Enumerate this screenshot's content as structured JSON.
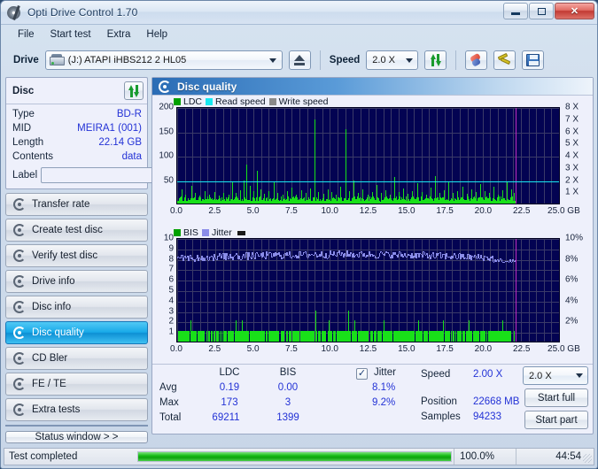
{
  "window": {
    "title": "Opti Drive Control 1.70",
    "icon": "disc-icon",
    "minimize_label": "–",
    "maximize_label": "□",
    "close_label": "✖"
  },
  "menu": {
    "items": [
      "File",
      "Start test",
      "Extra",
      "Help"
    ]
  },
  "toolbar": {
    "drive_label": "Drive",
    "drive_value": "(J:)  ATAPI iHBS212  2 HL05",
    "eject_label": "eject",
    "speed_label": "Speed",
    "speed_value": "2.0 X",
    "refresh_icon": "refresh-arrows-icon",
    "erase_icon": "erase-icon",
    "tools_icon": "tools-icon",
    "save_icon": "save-icon"
  },
  "disc_panel": {
    "title": "Disc",
    "refresh_icon": "refresh-arrows-icon",
    "rows": [
      {
        "key": "Type",
        "value": "BD-R"
      },
      {
        "key": "MID",
        "value": "MEIRA1 (001)"
      },
      {
        "key": "Length",
        "value": "22.14 GB"
      },
      {
        "key": "Contents",
        "value": "data"
      }
    ],
    "label_key": "Label",
    "label_value": "",
    "label_placeholder": "",
    "disc_icon": "cd-disc-icon"
  },
  "nav": {
    "items": [
      {
        "label": "Transfer rate",
        "active": false
      },
      {
        "label": "Create test disc",
        "active": false
      },
      {
        "label": "Verify test disc",
        "active": false
      },
      {
        "label": "Drive info",
        "active": false
      },
      {
        "label": "Disc info",
        "active": false
      },
      {
        "label": "Disc quality",
        "active": true
      },
      {
        "label": "CD Bler",
        "active": false
      },
      {
        "label": "FE / TE",
        "active": false
      },
      {
        "label": "Extra tests",
        "active": false
      }
    ],
    "status_window_label": "Status window > >"
  },
  "content": {
    "title": "Disc quality",
    "icon": "disc-quality-icon"
  },
  "chart_data": [
    {
      "type": "line",
      "name": "ldc-chart",
      "title": "",
      "xlabel": "GB",
      "ylabel": "",
      "xlim": [
        0.0,
        25.0
      ],
      "ylim": [
        0,
        200
      ],
      "y2lim": [
        0,
        8
      ],
      "y2label": "X",
      "grid": true,
      "legend_position": "top-left",
      "legend": [
        {
          "label": "LDC",
          "color": "#00a000"
        },
        {
          "label": "Read speed",
          "color": "#18e8f0"
        },
        {
          "label": "Write speed",
          "color": "#8a8a8a"
        }
      ],
      "xticks": [
        "0.0",
        "2.5",
        "5.0",
        "7.5",
        "10.0",
        "12.5",
        "15.0",
        "17.5",
        "20.0",
        "22.5",
        "25.0 GB"
      ],
      "xtick_values": [
        0,
        2.5,
        5,
        7.5,
        10,
        12.5,
        15,
        17.5,
        20,
        22.5,
        25
      ],
      "yticks": [
        "50",
        "100",
        "150",
        "200"
      ],
      "ytick_values": [
        50,
        100,
        150,
        200
      ],
      "y2ticks": [
        "1 X",
        "2 X",
        "3 X",
        "4 X",
        "5 X",
        "6 X",
        "7 X",
        "8 X"
      ],
      "y2tick_values": [
        1,
        2,
        3,
        4,
        5,
        6,
        7,
        8
      ],
      "data_end_gb": 22.14,
      "read_speed_series": {
        "name": "Read speed",
        "color": "#18e8f0",
        "constant_value_x": 2.0
      },
      "ldc_series": {
        "name": "LDC",
        "color": "#19e019",
        "x_start": 0.0,
        "x_end": 22.14,
        "baseline": 8,
        "peaks": [
          {
            "x": 0.3,
            "y": 30
          },
          {
            "x": 0.55,
            "y": 18
          },
          {
            "x": 0.9,
            "y": 36
          },
          {
            "x": 1.15,
            "y": 22
          },
          {
            "x": 1.45,
            "y": 17
          },
          {
            "x": 1.8,
            "y": 26
          },
          {
            "x": 2.1,
            "y": 19
          },
          {
            "x": 2.45,
            "y": 24
          },
          {
            "x": 2.7,
            "y": 16
          },
          {
            "x": 3.0,
            "y": 21
          },
          {
            "x": 3.35,
            "y": 18
          },
          {
            "x": 3.6,
            "y": 43
          },
          {
            "x": 3.85,
            "y": 22
          },
          {
            "x": 4.1,
            "y": 28
          },
          {
            "x": 4.35,
            "y": 48
          },
          {
            "x": 4.55,
            "y": 80
          },
          {
            "x": 4.75,
            "y": 37
          },
          {
            "x": 5.0,
            "y": 25
          },
          {
            "x": 5.2,
            "y": 68
          },
          {
            "x": 5.45,
            "y": 30
          },
          {
            "x": 5.7,
            "y": 20
          },
          {
            "x": 6.0,
            "y": 26
          },
          {
            "x": 6.3,
            "y": 44
          },
          {
            "x": 6.55,
            "y": 21
          },
          {
            "x": 6.9,
            "y": 18
          },
          {
            "x": 7.2,
            "y": 25
          },
          {
            "x": 7.5,
            "y": 33
          },
          {
            "x": 7.8,
            "y": 19
          },
          {
            "x": 8.1,
            "y": 27
          },
          {
            "x": 8.4,
            "y": 22
          },
          {
            "x": 8.7,
            "y": 31
          },
          {
            "x": 9.0,
            "y": 173
          },
          {
            "x": 9.25,
            "y": 24
          },
          {
            "x": 9.55,
            "y": 20
          },
          {
            "x": 9.85,
            "y": 29
          },
          {
            "x": 10.1,
            "y": 23
          },
          {
            "x": 10.4,
            "y": 18
          },
          {
            "x": 10.7,
            "y": 35
          },
          {
            "x": 11.0,
            "y": 153
          },
          {
            "x": 11.25,
            "y": 26
          },
          {
            "x": 11.55,
            "y": 47
          },
          {
            "x": 11.85,
            "y": 21
          },
          {
            "x": 12.15,
            "y": 30
          },
          {
            "x": 12.45,
            "y": 19
          },
          {
            "x": 12.75,
            "y": 24
          },
          {
            "x": 13.05,
            "y": 38
          },
          {
            "x": 13.35,
            "y": 22
          },
          {
            "x": 13.65,
            "y": 27
          },
          {
            "x": 13.95,
            "y": 18
          },
          {
            "x": 14.2,
            "y": 55
          },
          {
            "x": 14.5,
            "y": 23
          },
          {
            "x": 14.8,
            "y": 31
          },
          {
            "x": 15.1,
            "y": 20
          },
          {
            "x": 15.4,
            "y": 26
          },
          {
            "x": 15.7,
            "y": 42
          },
          {
            "x": 16.0,
            "y": 24
          },
          {
            "x": 16.3,
            "y": 19
          },
          {
            "x": 16.6,
            "y": 33
          },
          {
            "x": 16.9,
            "y": 57
          },
          {
            "x": 17.15,
            "y": 22
          },
          {
            "x": 17.45,
            "y": 28
          },
          {
            "x": 17.75,
            "y": 45
          },
          {
            "x": 18.05,
            "y": 21
          },
          {
            "x": 18.35,
            "y": 25
          },
          {
            "x": 18.65,
            "y": 35
          },
          {
            "x": 18.95,
            "y": 20
          },
          {
            "x": 19.25,
            "y": 29
          },
          {
            "x": 19.55,
            "y": 23
          },
          {
            "x": 19.85,
            "y": 40
          },
          {
            "x": 20.1,
            "y": 26
          },
          {
            "x": 20.4,
            "y": 21
          },
          {
            "x": 20.7,
            "y": 34
          },
          {
            "x": 21.0,
            "y": 19
          },
          {
            "x": 21.3,
            "y": 27
          },
          {
            "x": 21.6,
            "y": 44
          },
          {
            "x": 21.85,
            "y": 30
          },
          {
            "x": 22.05,
            "y": 22
          }
        ]
      }
    },
    {
      "type": "line",
      "name": "bis-jitter-chart",
      "title": "",
      "xlabel": "GB",
      "ylabel": "",
      "xlim": [
        0.0,
        25.0
      ],
      "ylim": [
        0,
        10
      ],
      "y2lim": [
        0,
        10
      ],
      "y2label": "%",
      "grid": true,
      "legend_position": "top-left",
      "legend": [
        {
          "label": "BIS",
          "color": "#00a000"
        },
        {
          "label": "Jitter",
          "color": "#8a8ce8"
        },
        {
          "label": "",
          "color": "#1a1a1a"
        }
      ],
      "xticks": [
        "0.0",
        "2.5",
        "5.0",
        "7.5",
        "10.0",
        "12.5",
        "15.0",
        "17.5",
        "20.0",
        "22.5",
        "25.0 GB"
      ],
      "xtick_values": [
        0,
        2.5,
        5,
        7.5,
        10,
        12.5,
        15,
        17.5,
        20,
        22.5,
        25
      ],
      "yticks": [
        "1",
        "2",
        "3",
        "4",
        "5",
        "6",
        "7",
        "8",
        "9",
        "10"
      ],
      "ytick_values": [
        1,
        2,
        3,
        4,
        5,
        6,
        7,
        8,
        9,
        10
      ],
      "y2ticks": [
        "2%",
        "4%",
        "6%",
        "8%",
        "10%"
      ],
      "y2tick_values": [
        2,
        4,
        6,
        8,
        10
      ],
      "data_end_gb": 22.14,
      "bis_series": {
        "name": "BIS",
        "color": "#19e019",
        "baseline": 1,
        "peaks": [
          {
            "x": 0.85,
            "y": 2
          },
          {
            "x": 3.8,
            "y": 2
          },
          {
            "x": 4.25,
            "y": 2
          },
          {
            "x": 9.05,
            "y": 3
          },
          {
            "x": 9.9,
            "y": 2
          },
          {
            "x": 11.2,
            "y": 3
          },
          {
            "x": 11.6,
            "y": 2
          },
          {
            "x": 13.5,
            "y": 2
          },
          {
            "x": 15.8,
            "y": 2
          },
          {
            "x": 17.4,
            "y": 2
          },
          {
            "x": 19.1,
            "y": 2
          },
          {
            "x": 21.3,
            "y": 2
          }
        ]
      },
      "jitter_series": {
        "name": "Jitter",
        "color": "#8a8ce8",
        "avg": 8.1,
        "max": 9.2,
        "range": [
          7.8,
          9.1
        ]
      }
    }
  ],
  "stats": {
    "headers": [
      "LDC",
      "BIS",
      "Jitter"
    ],
    "row_labels": [
      "Avg",
      "Max",
      "Total"
    ],
    "ldc": {
      "avg": "0.19",
      "max": "173",
      "total": "69211"
    },
    "bis": {
      "avg": "0.00",
      "max": "3",
      "total": "1399"
    },
    "jitter": {
      "avg": "8.1%",
      "max": "9.2%",
      "checked": true,
      "label": "Jitter"
    },
    "right": [
      {
        "key": "Speed",
        "value": "2.00 X"
      },
      {
        "key": "Position",
        "value": "22668 MB"
      },
      {
        "key": "Samples",
        "value": "94233"
      }
    ],
    "speed_select": "2.0 X",
    "start_full_label": "Start full",
    "start_part_label": "Start part"
  },
  "statusbar": {
    "text": "Test completed",
    "progress_percent": "100.0%",
    "progress_value": 100,
    "elapsed": "44:54"
  },
  "colors": {
    "accent_blue": "#2332d6",
    "active_nav": "#0d8fd4",
    "plot_bg": "#030352",
    "ldc_green": "#19e019",
    "read_speed_cyan": "#18e8f0",
    "jitter_purple": "#8a8ce8",
    "end_marker": "#c02bc0",
    "progress_green": "#16bb16"
  }
}
